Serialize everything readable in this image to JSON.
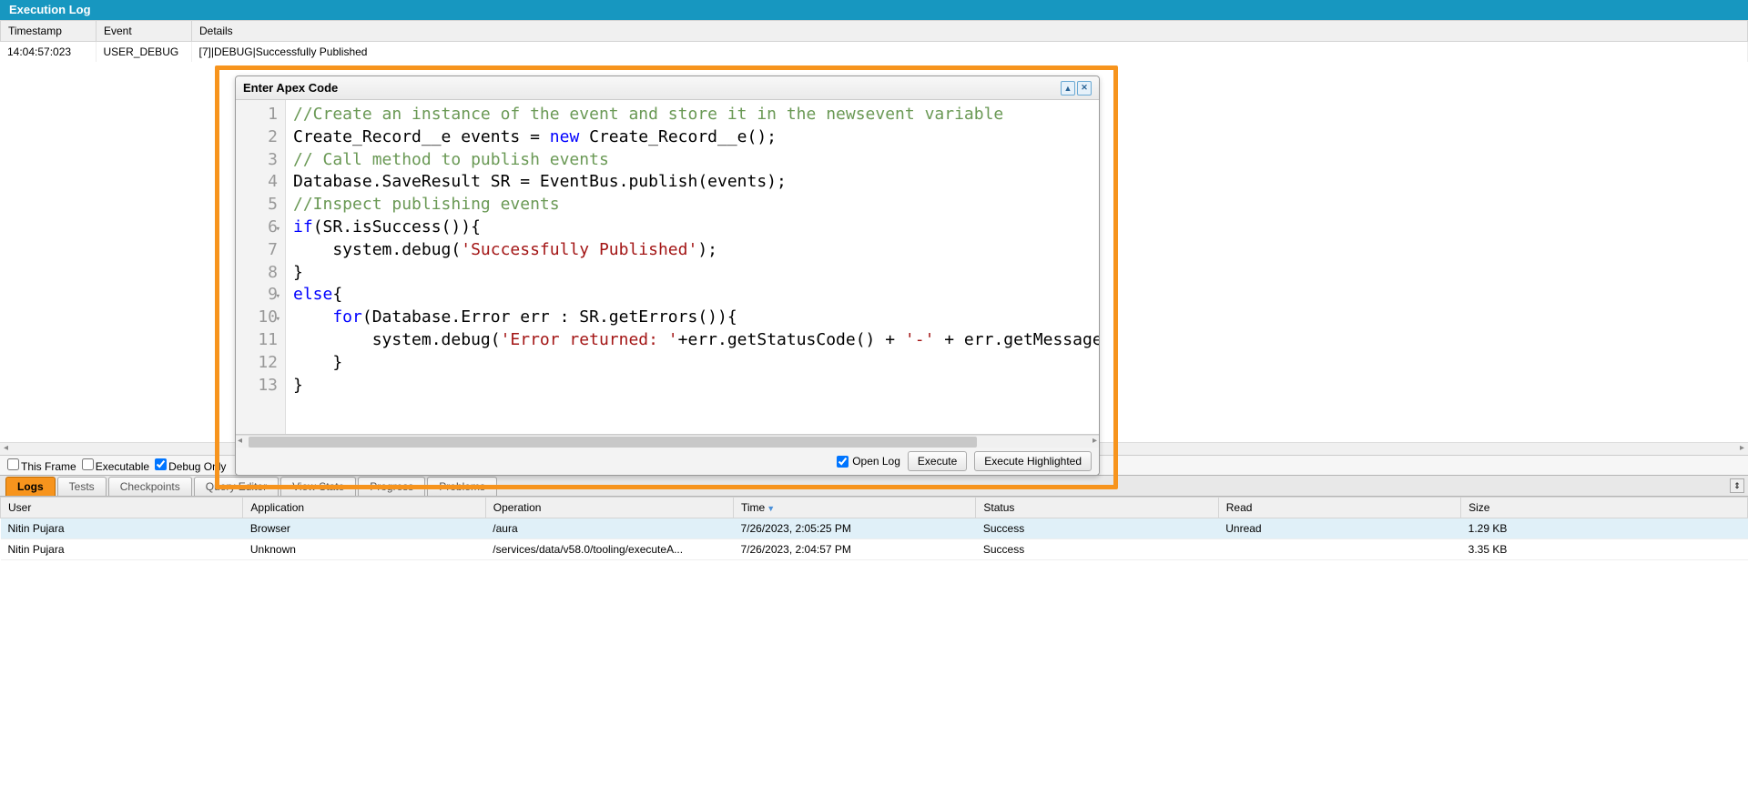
{
  "executionLog": {
    "title": "Execution Log",
    "headers": {
      "timestamp": "Timestamp",
      "event": "Event",
      "details": "Details"
    },
    "row": {
      "timestamp": "14:04:57:023",
      "event": "USER_DEBUG",
      "details": "[7]|DEBUG|Successfully Published"
    }
  },
  "filter": {
    "thisFrame": "This Frame",
    "executable": "Executable",
    "debugOnly": "Debug Only"
  },
  "tabs": {
    "logs": "Logs",
    "tests": "Tests",
    "checkpoints": "Checkpoints",
    "queryEditor": "Query Editor",
    "viewState": "View State",
    "progress": "Progress",
    "problems": "Problems"
  },
  "logsGrid": {
    "headers": {
      "user": "User",
      "application": "Application",
      "operation": "Operation",
      "time": "Time",
      "status": "Status",
      "read": "Read",
      "size": "Size"
    },
    "rows": [
      {
        "user": "Nitin Pujara",
        "application": "Browser",
        "operation": "/aura",
        "time": "7/26/2023, 2:05:25 PM",
        "status": "Success",
        "read": "Unread",
        "size": "1.29 KB"
      },
      {
        "user": "Nitin Pujara",
        "application": "Unknown",
        "operation": "/services/data/v58.0/tooling/executeA...",
        "time": "7/26/2023, 2:04:57 PM",
        "status": "Success",
        "read": "",
        "size": "3.35 KB"
      }
    ]
  },
  "apex": {
    "title": "Enter Apex Code",
    "openLog": "Open Log",
    "execute": "Execute",
    "executeHighlighted": "Execute Highlighted",
    "code": {
      "l1_c": "//Create an instance of the event and store it in the newsevent variable",
      "l2_a": "Create_Record__e events = ",
      "l2_kw": "new",
      "l2_b": " Create_Record__e();",
      "l3_c": "// Call method to publish events",
      "l4": "Database.SaveResult SR = EventBus.publish(events);",
      "l5_c": "//Inspect publishing events",
      "l6_kw": "if",
      "l6_rest": "(SR.isSuccess()){",
      "l7_a": "    system.debug(",
      "l7_s": "'Successfully Published'",
      "l7_b": ");",
      "l8": "}",
      "l9_kw": "else",
      "l9_rest": "{",
      "l10_kw": "    for",
      "l10_rest": "(Database.Error err : SR.getErrors()){",
      "l11_a": "        system.debug(",
      "l11_s1": "'Error returned: '",
      "l11_mid": "+err.getStatusCode() + ",
      "l11_s2": "'-'",
      "l11_end": " + err.getMessage());",
      "l12": "    }",
      "l13": "}"
    }
  }
}
